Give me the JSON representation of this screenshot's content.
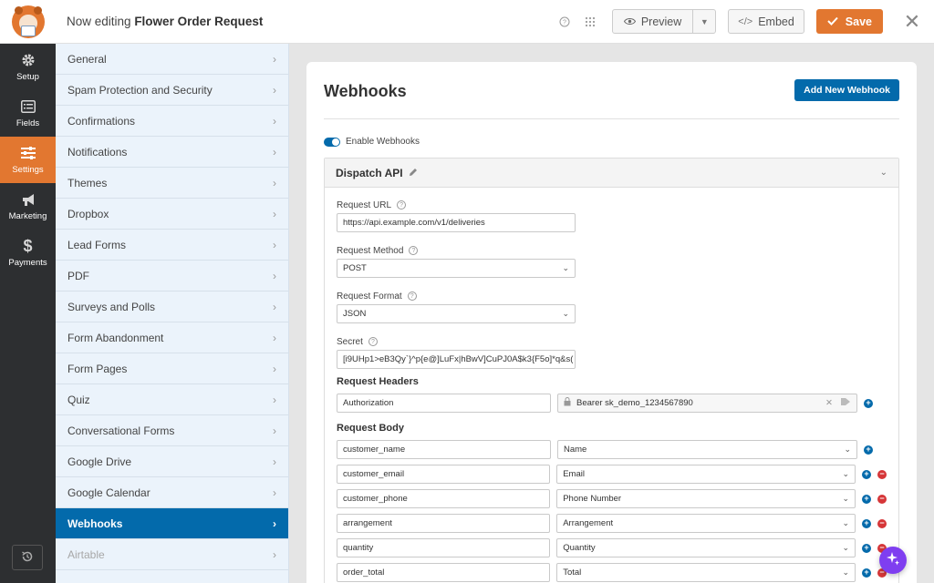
{
  "header": {
    "editing_prefix": "Now editing",
    "form_name": "Flower Order Request",
    "preview_label": "Preview",
    "embed_label": "Embed",
    "save_label": "Save"
  },
  "leftnav": {
    "items": [
      {
        "label": "Setup",
        "icon": "gear-icon",
        "active": false
      },
      {
        "label": "Fields",
        "icon": "fields-list-icon",
        "active": false
      },
      {
        "label": "Settings",
        "icon": "sliders-icon",
        "active": true
      },
      {
        "label": "Marketing",
        "icon": "megaphone-icon",
        "active": false
      },
      {
        "label": "Payments",
        "icon": "dollar-icon",
        "active": false
      }
    ]
  },
  "settings_panel": {
    "items": [
      {
        "label": "General"
      },
      {
        "label": "Spam Protection and Security"
      },
      {
        "label": "Confirmations"
      },
      {
        "label": "Notifications"
      },
      {
        "label": "Themes"
      },
      {
        "label": "Dropbox"
      },
      {
        "label": "Lead Forms"
      },
      {
        "label": "PDF"
      },
      {
        "label": "Surveys and Polls"
      },
      {
        "label": "Form Abandonment"
      },
      {
        "label": "Form Pages"
      },
      {
        "label": "Quiz"
      },
      {
        "label": "Conversational Forms"
      },
      {
        "label": "Google Drive"
      },
      {
        "label": "Google Calendar"
      },
      {
        "label": "Webhooks"
      },
      {
        "label": "Airtable"
      }
    ],
    "active_index": 15,
    "disabled_index": 16
  },
  "main": {
    "title": "Webhooks",
    "add_button": "Add New Webhook",
    "enable_label": "Enable Webhooks",
    "webhook": {
      "name": "Dispatch API",
      "request_url_label": "Request URL",
      "request_url": "https://api.example.com/v1/deliveries",
      "method_label": "Request Method",
      "method": "POST",
      "format_label": "Request Format",
      "format": "JSON",
      "secret_label": "Secret",
      "secret": "[i9UHp1>eB3Qy`}^p{e@]LuFx|hBwV]CuPJ0A$k3{F5o]*q&s(",
      "headers_title": "Request Headers",
      "headers": [
        {
          "key": "Authorization",
          "value": "Bearer sk_demo_1234567890"
        }
      ],
      "body_title": "Request Body",
      "body": [
        {
          "key": "customer_name",
          "value": "Name",
          "removable": false
        },
        {
          "key": "customer_email",
          "value": "Email",
          "removable": true
        },
        {
          "key": "customer_phone",
          "value": "Phone Number",
          "removable": true
        },
        {
          "key": "arrangement",
          "value": "Arrangement",
          "removable": true
        },
        {
          "key": "quantity",
          "value": "Quantity",
          "removable": true
        },
        {
          "key": "order_total",
          "value": "Total",
          "removable": true
        }
      ]
    }
  }
}
